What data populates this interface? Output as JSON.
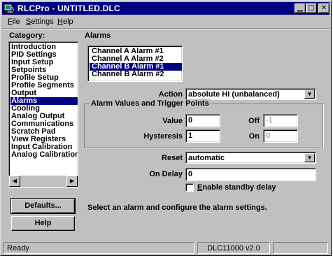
{
  "titlebar": {
    "title": "RLCPro - UNTITLED.DLC",
    "minimize_glyph": "▁",
    "maximize_glyph": "□",
    "close_glyph": "✕"
  },
  "menu": [
    {
      "label": "File",
      "mnemonic": "F"
    },
    {
      "label": "Settings",
      "mnemonic": "S"
    },
    {
      "label": "Help",
      "mnemonic": "H"
    }
  ],
  "category_heading": "Category:",
  "categories": [
    "Introduction",
    "PID Settings",
    "Input Setup",
    "Setpoints",
    "Profile Setup",
    "Profile Segments",
    "Output",
    "Alarms",
    "Cooling",
    "Analog Output",
    "Communications",
    "Scratch Pad",
    "View Registers",
    "Input Calibration",
    "Analog Calibration"
  ],
  "selected_category": "Alarms",
  "buttons": {
    "defaults": "Defaults...",
    "help": "Help"
  },
  "section_title": "Alarms",
  "alarms": [
    "Channel A Alarm #1",
    "Channel A Alarm #2",
    "Channel B Alarm #1",
    "Channel B Alarm #2"
  ],
  "selected_alarm": "Channel B Alarm #1",
  "action": {
    "label": "Action",
    "value": "absolute HI (unbalanced)"
  },
  "group_title": "Alarm Values and Trigger Points",
  "value_field": {
    "label": "Value",
    "value": "0"
  },
  "off_field": {
    "label": "Off",
    "value": "-1"
  },
  "hysteresis_field": {
    "label": "Hysteresis",
    "value": "1"
  },
  "on_field": {
    "label": "On",
    "value": "0"
  },
  "reset": {
    "label": "Reset",
    "value": "automatic"
  },
  "on_delay": {
    "label": "On Delay",
    "value": "0"
  },
  "standby": {
    "label": "Enable standby delay",
    "mnemonic": "E",
    "checked": false
  },
  "hint": "Select an alarm and configure the alarm settings.",
  "status": {
    "left": "Ready",
    "center": "DLC11000 v2.0",
    "right": ""
  }
}
